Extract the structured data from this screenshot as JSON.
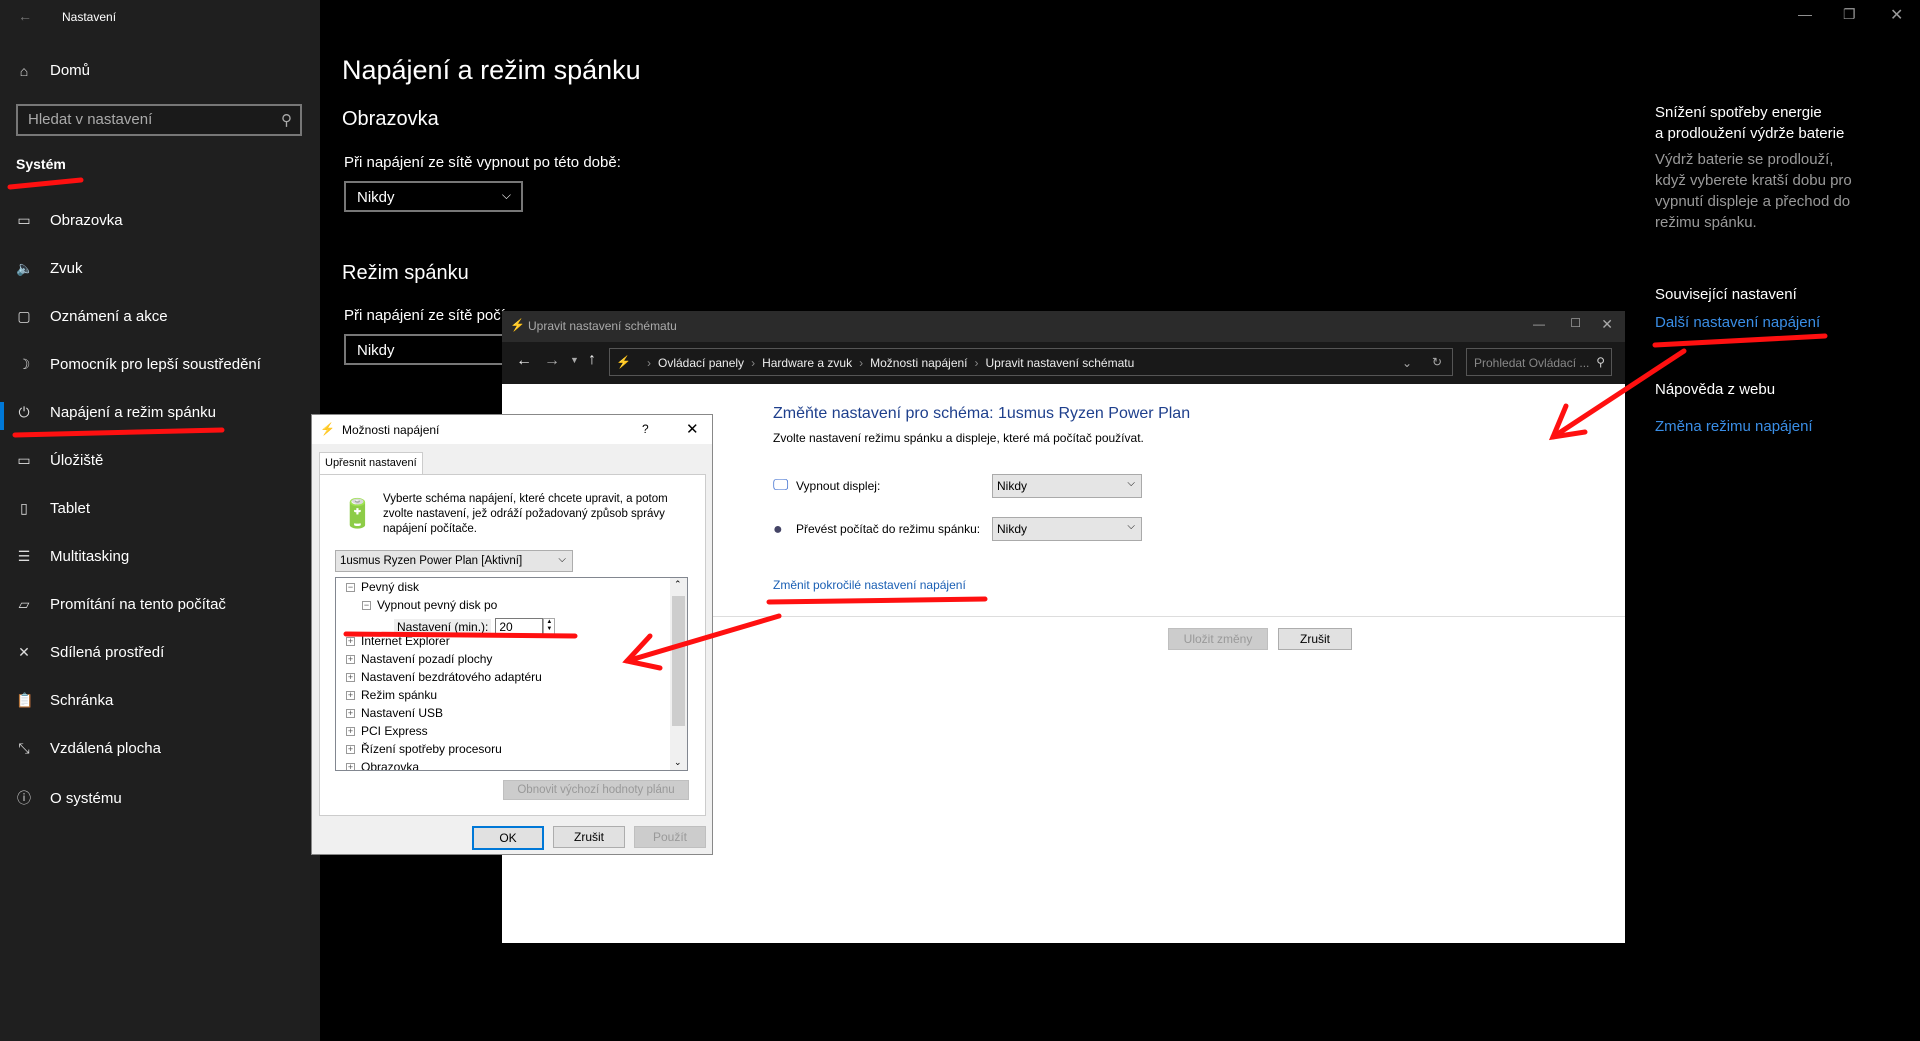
{
  "settings": {
    "app_title": "Nastavení",
    "home": "Domů",
    "search_placeholder": "Hledat v nastavení",
    "section": "Systém",
    "nav": [
      {
        "label": "Obrazovka",
        "icon": "monitor-icon"
      },
      {
        "label": "Zvuk",
        "icon": "speaker-icon"
      },
      {
        "label": "Oznámení a akce",
        "icon": "notification-icon"
      },
      {
        "label": "Pomocník pro lepší soustředění",
        "icon": "moon-icon"
      },
      {
        "label": "Napájení a režim spánku",
        "icon": "power-icon",
        "selected": true
      },
      {
        "label": "Úložiště",
        "icon": "storage-icon"
      },
      {
        "label": "Tablet",
        "icon": "tablet-icon"
      },
      {
        "label": "Multitasking",
        "icon": "multitasking-icon"
      },
      {
        "label": "Promítání na tento počítač",
        "icon": "projecting-icon"
      },
      {
        "label": "Sdílená prostředí",
        "icon": "shared-icon"
      },
      {
        "label": "Schránka",
        "icon": "clipboard-icon"
      },
      {
        "label": "Vzdálená plocha",
        "icon": "remote-desktop-icon"
      },
      {
        "label": "O systému",
        "icon": "info-icon"
      }
    ],
    "page_title": "Napájení a režim spánku",
    "screen_heading": "Obrazovka",
    "screen_label": "Při napájení ze sítě vypnout po této době:",
    "screen_value": "Nikdy",
    "sleep_heading": "Režim spánku",
    "sleep_label": "Při napájení ze sítě počí",
    "sleep_value": "Nikdy",
    "aside": {
      "tip_title_1": "Snížení spotřeby energie",
      "tip_title_2": "a prodloužení výdrže baterie",
      "tip_text": "Výdrž baterie se prodlouží, když vyberete kratší dobu pro vypnutí displeje a přechod do režimu spánku.",
      "related_heading": "Související nastavení",
      "related_link": "Další nastavení napájení",
      "help_heading": "Nápověda z webu",
      "help_link": "Změna režimu napájení"
    }
  },
  "control_panel": {
    "title": "Upravit nastavení schématu",
    "breadcrumb": [
      "Ovládací panely",
      "Hardware a zvuk",
      "Možnosti napájení",
      "Upravit nastavení schématu"
    ],
    "search_placeholder": "Prohledat Ovládací ...",
    "heading": "Změňte nastavení pro schéma: 1usmus Ryzen Power Plan",
    "subtitle": "Zvolte nastavení režimu spánku a displeje, které má počítač používat.",
    "display_label": "Vypnout displej:",
    "display_value": "Nikdy",
    "sleep_label": "Převést počítač do režimu spánku:",
    "sleep_value": "Nikdy",
    "advanced_link": "Změnit pokročilé nastavení napájení",
    "save": "Uložit změny",
    "cancel": "Zrušit"
  },
  "dialog": {
    "title": "Možnosti napájení",
    "help": "?",
    "tab": "Upřesnit nastavení",
    "description": "Vyberte schéma napájení, které chcete upravit, a potom zvolte nastavení, jež odráží požadovaný způsob správy napájení počítače.",
    "plan": "1usmus Ryzen Power Plan [Aktivní]",
    "tree": [
      {
        "label": "Pevný disk",
        "level": 0,
        "expanded": true
      },
      {
        "label": "Vypnout pevný disk po",
        "level": 1,
        "expanded": true
      },
      {
        "label": "Internet Explorer",
        "level": 0
      },
      {
        "label": "Nastavení pozadí plochy",
        "level": 0
      },
      {
        "label": "Nastavení bezdrátového adaptéru",
        "level": 0
      },
      {
        "label": "Režim spánku",
        "level": 0
      },
      {
        "label": "Nastavení USB",
        "level": 0
      },
      {
        "label": "PCI Express",
        "level": 0
      },
      {
        "label": "Řízení spotřeby procesoru",
        "level": 0
      },
      {
        "label": "Obrazovka",
        "level": 0
      }
    ],
    "setting_label": "Nastavení (min.):",
    "setting_value": "20",
    "restore": "Obnovit výchozí hodnoty plánu",
    "ok": "OK",
    "cancel": "Zrušit",
    "apply": "Použít"
  },
  "annotation_color": "#ff1010"
}
